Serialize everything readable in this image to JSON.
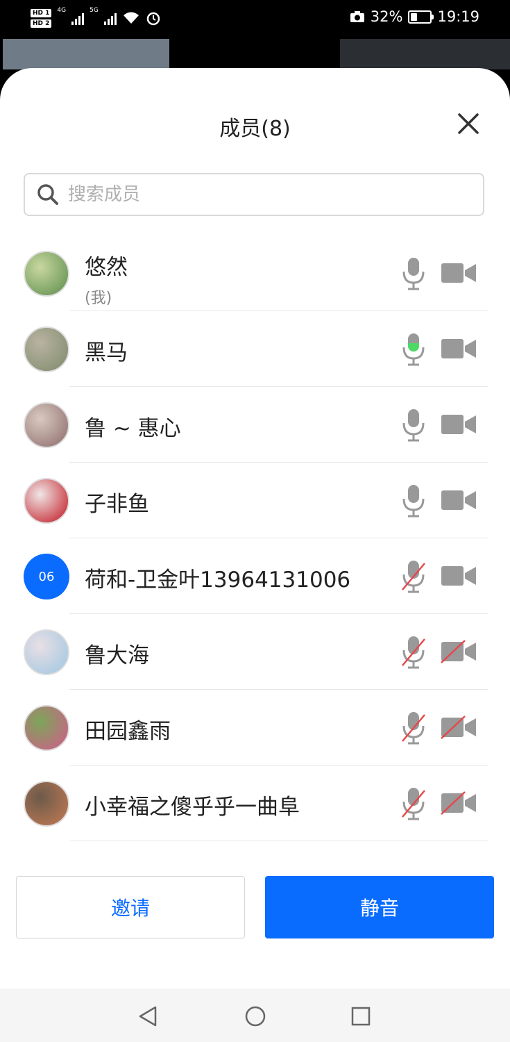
{
  "status_bar": {
    "hd1": "HD 1",
    "hd2": "HD 2",
    "net1": "4G",
    "net2": "5G",
    "battery_percent": "32%",
    "battery_level": 0.32,
    "time": "19:19"
  },
  "panel": {
    "title": "成员(8)",
    "search_placeholder": "搜索成员"
  },
  "members": [
    {
      "name": "悠然",
      "sub": "(我)",
      "avatar_colors": [
        "#5a8c4a",
        "#c8d7a0"
      ],
      "mic": "on",
      "cam": "on"
    },
    {
      "name": "黑马",
      "avatar_colors": [
        "#7d8a6a",
        "#b9b3a1"
      ],
      "mic": "speaking",
      "cam": "on"
    },
    {
      "name": "鲁 ~ 惠心",
      "avatar_colors": [
        "#8c6a6a",
        "#d8c9c0"
      ],
      "mic": "on",
      "cam": "on"
    },
    {
      "name": "子非鱼",
      "avatar_colors": [
        "#c0121c",
        "#f0e6e6"
      ],
      "mic": "on",
      "cam": "on"
    },
    {
      "name": "荷和-卫金叶13964131006",
      "avatar_initials": "06",
      "mic": "off",
      "cam": "on"
    },
    {
      "name": "鲁大海",
      "avatar_colors": [
        "#9dc6e2",
        "#e9dfe4"
      ],
      "mic": "off",
      "cam": "off"
    },
    {
      "name": "田园鑫雨",
      "avatar_colors": [
        "#d45a8c",
        "#7ca65a"
      ],
      "mic": "off",
      "cam": "off"
    },
    {
      "name": "小幸福之傻乎乎一曲阜",
      "avatar_colors": [
        "#c47b54",
        "#6d5a4a"
      ],
      "mic": "off",
      "cam": "off"
    }
  ],
  "actions": {
    "invite": "邀请",
    "mute": "静音"
  },
  "icons": {
    "close": "close-icon",
    "search": "search-icon",
    "mic": "microphone-icon",
    "cam": "video-camera-icon",
    "nav_back": "back-triangle-icon",
    "nav_home": "home-circle-icon",
    "nav_recent": "recent-square-icon"
  },
  "colors": {
    "accent": "#0a6cff",
    "icon_gray": "#999999",
    "speaking_green": "#4cd964",
    "muted_red": "#e5484d"
  }
}
